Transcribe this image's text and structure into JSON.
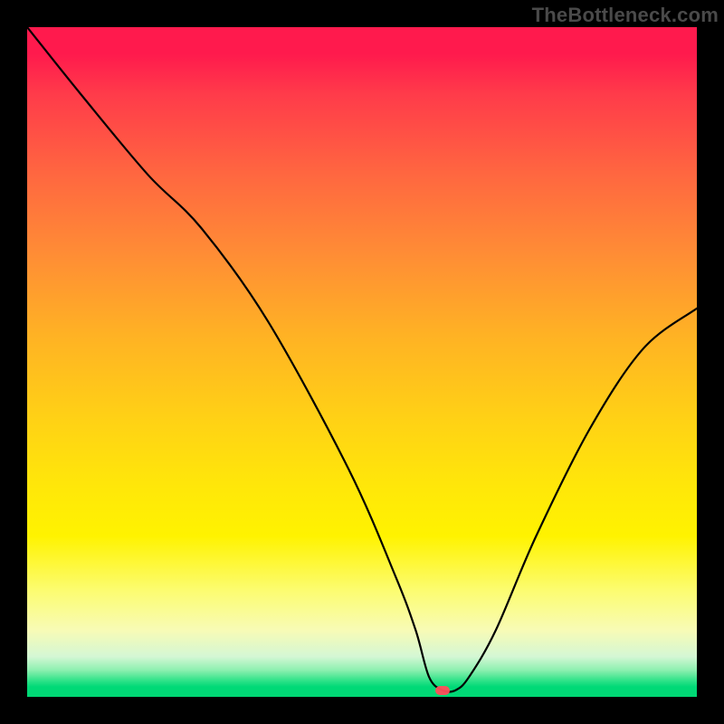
{
  "watermark": "TheBottleneck.com",
  "colors": {
    "frame": "#000000",
    "curve": "#000000",
    "marker": "#ff4d5a"
  },
  "chart_data": {
    "type": "line",
    "title": "",
    "xlabel": "",
    "ylabel": "",
    "xlim": [
      0,
      100
    ],
    "ylim": [
      0,
      100
    ],
    "grid": false,
    "legend": false,
    "note": "Background is a vertical heat gradient (red→yellow→green); black curve is a bottleneck V-curve; red pill marks the minimum.",
    "series": [
      {
        "name": "bottleneck-curve",
        "x": [
          0,
          8,
          18,
          26,
          36,
          48,
          55,
          58,
          60,
          62,
          64,
          66,
          70,
          76,
          84,
          92,
          100
        ],
        "y": [
          100,
          90,
          78,
          70,
          56,
          34,
          18,
          10,
          3,
          1,
          1,
          3,
          10,
          24,
          40,
          52,
          58
        ]
      }
    ],
    "marker": {
      "x": 62,
      "y": 1
    },
    "gradient_stops": [
      {
        "pos": 0,
        "color": "#ff1a4d"
      },
      {
        "pos": 46,
        "color": "#ffb224"
      },
      {
        "pos": 76,
        "color": "#fff300"
      },
      {
        "pos": 97,
        "color": "#33e38a"
      },
      {
        "pos": 100,
        "color": "#00d874"
      }
    ]
  }
}
